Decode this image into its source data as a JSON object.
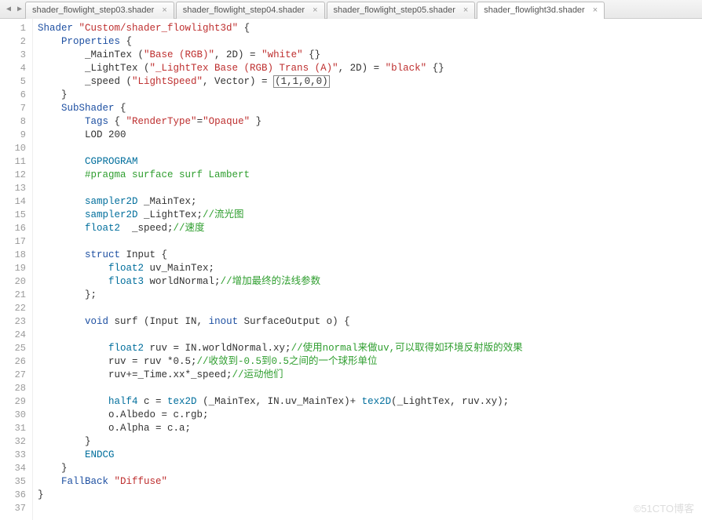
{
  "tabs": [
    {
      "label": "shader_flowlight_step03.shader"
    },
    {
      "label": "shader_flowlight_step04.shader"
    },
    {
      "label": "shader_flowlight_step05.shader"
    },
    {
      "label": "shader_flowlight3d.shader"
    }
  ],
  "watermark": "©51CTO博客",
  "code": {
    "l1": {
      "a": "Shader",
      "b": "\"Custom/shader_flowlight3d\"",
      "c": " {"
    },
    "l2": {
      "a": "Properties",
      "b": " {"
    },
    "l3": {
      "a": "_MainTex (",
      "b": "\"Base (RGB)\"",
      "c": ", 2D) = ",
      "d": "\"white\"",
      "e": " {}"
    },
    "l4": {
      "a": "_LightTex (",
      "b": "\"_LightTex Base (RGB) Trans (A)\"",
      "c": ", 2D) = ",
      "d": "\"black\"",
      "e": " {}"
    },
    "l5": {
      "a": "_speed (",
      "b": "\"LightSpeed\"",
      "c": ", Vector) = ",
      "d": "(1,1,0,0)"
    },
    "l6": "}",
    "l7": {
      "a": "SubShader",
      "b": " {"
    },
    "l8": {
      "a": "Tags",
      "b": " { ",
      "c": "\"RenderType\"",
      "d": "=",
      "e": "\"Opaque\"",
      "f": " }"
    },
    "l9": "LOD 200",
    "l11": "CGPROGRAM",
    "l12": "#pragma surface surf Lambert",
    "l14": {
      "a": "sampler2D",
      "b": " _MainTex;"
    },
    "l15": {
      "a": "sampler2D",
      "b": " _LightTex;",
      "c": "//流光图"
    },
    "l16": {
      "a": "float2",
      "b": "  _speed;",
      "c": "//速度"
    },
    "l18": {
      "a": "struct",
      "b": " Input {"
    },
    "l19": {
      "a": "float2",
      "b": " uv_MainTex;"
    },
    "l20": {
      "a": "float3",
      "b": " worldNormal;",
      "c": "//增加最终的法线参数"
    },
    "l21": "};",
    "l23": {
      "a": "void",
      "b": " surf (Input IN, ",
      "c": "inout",
      "d": " SurfaceOutput o) {"
    },
    "l25": {
      "a": "float2",
      "b": " ruv = IN.worldNormal.xy;",
      "c": "//使用normal来做uv,可以取得如环境反射版的效果"
    },
    "l26": {
      "a": "ruv = ruv *0.5;",
      "b": "//收敛到-0.5到0.5之间的一个球形单位"
    },
    "l27": {
      "a": "ruv+=_Time.xx*_speed;",
      "b": "//运动他们"
    },
    "l29": {
      "a": "half4",
      "b": " c = ",
      "c": "tex2D",
      "d": " (_MainTex, IN.uv_MainTex)+ ",
      "e": "tex2D",
      "f": "(_LightTex, ruv.xy);"
    },
    "l30": "o.Albedo = c.rgb;",
    "l31": "o.Alpha = c.a;",
    "l32": "}",
    "l33": "ENDCG",
    "l34": "}",
    "l35": {
      "a": "FallBack",
      "b": " ",
      "c": "\"Diffuse\""
    },
    "l36": "}"
  }
}
